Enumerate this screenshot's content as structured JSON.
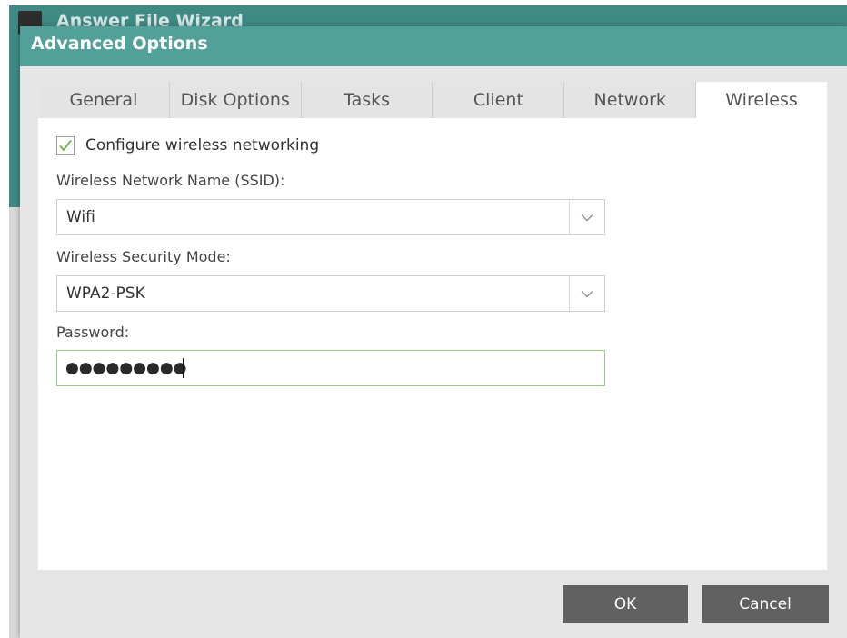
{
  "background_window": {
    "title": "Answer File Wizard"
  },
  "dialog": {
    "title": "Advanced Options",
    "tabs": [
      {
        "label": "General"
      },
      {
        "label": "Disk Options"
      },
      {
        "label": "Tasks"
      },
      {
        "label": "Client"
      },
      {
        "label": "Network"
      },
      {
        "label": "Wireless"
      }
    ],
    "active_tab": "Wireless"
  },
  "wireless": {
    "configure_checkbox": {
      "label": "Configure wireless networking",
      "checked": true
    },
    "ssid": {
      "label": "Wireless Network Name (SSID):",
      "value": "Wifi"
    },
    "security_mode": {
      "label": "Wireless Security Mode:",
      "value": "WPA2-PSK"
    },
    "password": {
      "label": "Password:",
      "masked_value": "●●●●●●●●●"
    }
  },
  "buttons": {
    "ok": "OK",
    "cancel": "Cancel"
  },
  "colors": {
    "titlebar": "#52a09a",
    "background_titlebar": "#3f8a84",
    "button": "#616161",
    "check": "#6aae3f",
    "password_border": "#9ccb7e"
  },
  "icons": {
    "checkbox_mark": "checkmark-icon",
    "dropdown": "chevron-down-icon"
  }
}
